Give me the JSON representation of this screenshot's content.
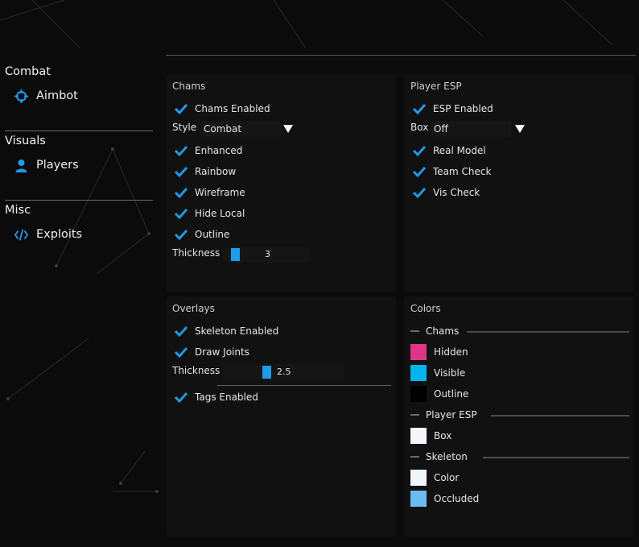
{
  "sidebar": {
    "categories": [
      {
        "label": "Combat",
        "item": "Aimbot",
        "icon": "crosshair-icon"
      },
      {
        "label": "Visuals",
        "item": "Players",
        "icon": "person-icon"
      },
      {
        "label": "Misc",
        "item": "Exploits",
        "icon": "code-icon"
      }
    ]
  },
  "chams": {
    "title": "Chams",
    "enabled_label": "Chams Enabled",
    "style_label": "Style",
    "style_value": "Combat",
    "enhanced_label": "Enhanced",
    "rainbow_label": "Rainbow",
    "wireframe_label": "Wireframe",
    "hide_local_label": "Hide Local",
    "outline_label": "Outline",
    "thickness_label": "Thickness",
    "thickness_value": "3",
    "thickness_fraction": 0.1
  },
  "esp": {
    "title": "Player ESP",
    "enabled_label": "ESP Enabled",
    "box_label": "Box",
    "box_value": "Off",
    "real_model_label": "Real Model",
    "team_check_label": "Team Check",
    "vis_check_label": "Vis Check"
  },
  "overlays": {
    "title": "Overlays",
    "skeleton_label": "Skeleton Enabled",
    "joints_label": "Draw Joints",
    "thickness_label": "Thickness",
    "thickness_value": "2.5",
    "thickness_fraction": 0.35,
    "tags_label": "Tags Enabled"
  },
  "colors": {
    "title": "Colors",
    "chams_header": "Chams",
    "hidden_label": "Hidden",
    "visible_label": "Visible",
    "outline_label": "Outline",
    "esp_header": "Player ESP",
    "box_label": "Box",
    "skeleton_header": "Skeleton",
    "color_label": "Color",
    "occluded_label": "Occluded",
    "swatches": {
      "hidden": "#e0348a",
      "visible": "#00b4f0",
      "outline": "#000000",
      "box": "#f4f6fa",
      "skeleton_color": "#eef6fb",
      "occluded": "#6cbcf2"
    }
  },
  "theme": {
    "accent": "#1e9be9",
    "check": "#1e9be9"
  }
}
